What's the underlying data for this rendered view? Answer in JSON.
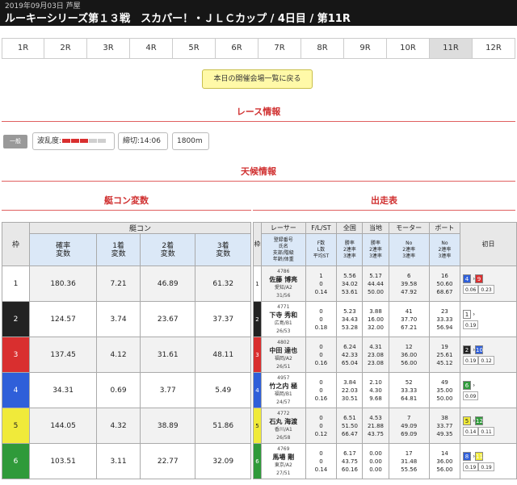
{
  "header": {
    "date": "2019年09月03日 芦屋",
    "title": "ルーキーシリーズ第１３戦　スカパー！・ＪＬＣカップ / 4日目 / 第11R"
  },
  "race_tabs": [
    "1R",
    "2R",
    "3R",
    "4R",
    "5R",
    "6R",
    "7R",
    "8R",
    "9R",
    "10R",
    "11R",
    "12R"
  ],
  "active_tab": "11R",
  "back_button": "本日の開催会場一覧に戻る",
  "sections": {
    "race_info": "レース情報",
    "weather": "天候情報",
    "motor": "艇コン変数",
    "entry": "出走表"
  },
  "race_info": {
    "badge": "一般",
    "wave_label": "波乱度:",
    "deadline": "締切:14:06",
    "distance": "1800m"
  },
  "colors": {
    "accent": "#d03030",
    "wave_on": "#d92f2f",
    "wave_off": "#cfcfcf"
  },
  "wave_level": 3,
  "wave_total": 5,
  "motor_table": {
    "frame_header": "枠",
    "group_header": "艇コン",
    "col_headers": [
      "確率\n変数",
      "1着\n変数",
      "2着\n変数",
      "3着\n変数"
    ],
    "rows": [
      {
        "frame": "1",
        "c1": "180.36",
        "c2": "7.21",
        "c3": "46.89",
        "c4": "61.32"
      },
      {
        "frame": "2",
        "c1": "124.57",
        "c2": "3.74",
        "c3": "23.67",
        "c4": "37.37"
      },
      {
        "frame": "3",
        "c1": "137.45",
        "c2": "4.12",
        "c3": "31.61",
        "c4": "48.11"
      },
      {
        "frame": "4",
        "c1": "34.31",
        "c2": "0.69",
        "c3": "3.77",
        "c4": "5.49"
      },
      {
        "frame": "5",
        "c1": "144.05",
        "c2": "4.32",
        "c3": "38.89",
        "c4": "51.86"
      },
      {
        "frame": "6",
        "c1": "103.51",
        "c2": "3.11",
        "c3": "22.77",
        "c4": "32.09"
      }
    ]
  },
  "entry_table": {
    "frame_header": "枠",
    "headers": [
      "レーサー",
      "F/L/ST",
      "全国",
      "当地",
      "モーター",
      "ボート"
    ],
    "sub_headers": [
      "登録番号\n氏名\n支部/階級\n年齢/体重",
      "F数\nL数\n平均ST",
      "勝率\n2連率\n3連率",
      "勝率\n2連率\n3連率",
      "No\n2連率\n3連率",
      "No\n2連率\n3連率"
    ],
    "day_header": "初日",
    "rows": [
      {
        "frame": "1",
        "reg": "4786",
        "name": "佐藤 博亮",
        "branch": "愛知/A2",
        "age": "31/56",
        "f": "1",
        "l": "0",
        "st": "0.14",
        "n1": "5.56",
        "n2": "34.02",
        "n3": "53.61",
        "l1": "5.17",
        "l2": "44.44",
        "l3": "50.00",
        "m1": "6",
        "m2": "39.58",
        "m3": "47.92",
        "b1": "16",
        "b2": "50.60",
        "b3": "68.67",
        "r1a": "4",
        "r1b": "0.06",
        "r2a": "9",
        "r2b": "0.23"
      },
      {
        "frame": "2",
        "reg": "4771",
        "name": "下寺 秀和",
        "branch": "広島/B1",
        "age": "26/53",
        "f": "0",
        "l": "0",
        "st": "0.18",
        "n1": "5.23",
        "n2": "34.43",
        "n3": "53.28",
        "l1": "3.88",
        "l2": "16.00",
        "l3": "32.00",
        "m1": "41",
        "m2": "37.70",
        "m3": "67.21",
        "b1": "23",
        "b2": "33.33",
        "b3": "56.94",
        "r1a": "1",
        "r1b": "0.19",
        "r2a": "",
        "r2b": ""
      },
      {
        "frame": "3",
        "reg": "4802",
        "name": "中田 達也",
        "branch": "福岡/A2",
        "age": "26/51",
        "f": "0",
        "l": "0",
        "st": "0.16",
        "n1": "6.24",
        "n2": "42.33",
        "n3": "65.04",
        "l1": "4.31",
        "l2": "23.08",
        "l3": "23.08",
        "m1": "12",
        "m2": "36.00",
        "m3": "56.00",
        "b1": "19",
        "b2": "25.61",
        "b3": "45.12",
        "r1a": "2",
        "r1b": "0.19",
        "r2a": "10",
        "r2b": "0.12"
      },
      {
        "frame": "4",
        "reg": "4957",
        "name": "竹之内 極",
        "branch": "福岡/B1",
        "age": "24/57",
        "f": "0",
        "l": "0",
        "st": "0.16",
        "n1": "3.84",
        "n2": "22.03",
        "n3": "30.51",
        "l1": "2.10",
        "l2": "4.30",
        "l3": "9.68",
        "m1": "52",
        "m2": "33.33",
        "m3": "64.81",
        "b1": "49",
        "b2": "35.00",
        "b3": "50.00",
        "r1a": "6",
        "r1b": "0.09",
        "r2a": "",
        "r2b": ""
      },
      {
        "frame": "5",
        "reg": "4772",
        "name": "石丸 海渡",
        "branch": "香川/A1",
        "age": "26/58",
        "f": "0",
        "l": "0",
        "st": "0.12",
        "n1": "6.51",
        "n2": "51.50",
        "n3": "66.47",
        "l1": "4.53",
        "l2": "21.88",
        "l3": "43.75",
        "m1": "7",
        "m2": "49.09",
        "m3": "69.09",
        "b1": "38",
        "b2": "33.77",
        "b3": "49.35",
        "r1a": "5",
        "r1b": "0.14",
        "r2a": "12",
        "r2b": "0.11"
      },
      {
        "frame": "6",
        "reg": "4769",
        "name": "馬場 剛",
        "branch": "東京/A2",
        "age": "27/51",
        "f": "0",
        "l": "0",
        "st": "0.14",
        "n1": "6.17",
        "n2": "43.75",
        "n3": "60.16",
        "l1": "0.00",
        "l2": "0.00",
        "l3": "0.00",
        "m1": "17",
        "m2": "31.48",
        "m3": "55.56",
        "b1": "14",
        "b2": "36.00",
        "b3": "56.00",
        "r1a": "8",
        "r1b": "0.19",
        "r2a": "11",
        "r2b": "0.19"
      }
    ]
  }
}
